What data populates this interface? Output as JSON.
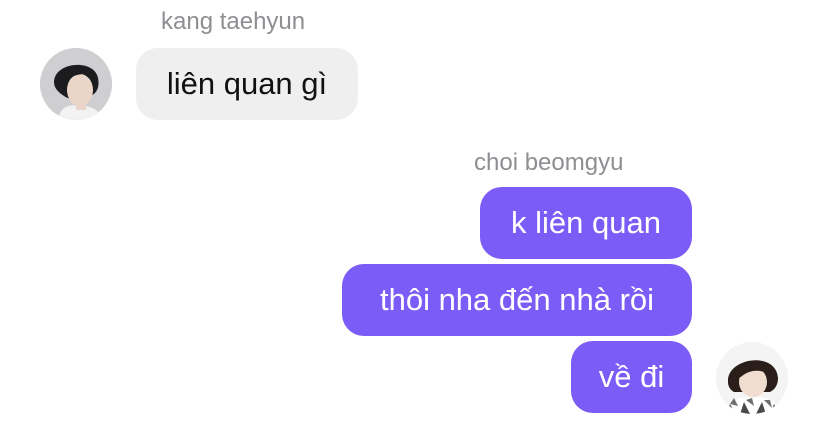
{
  "conversation": {
    "incoming": {
      "sender_name": "kang taehyun",
      "avatar_icon": "user-avatar-icon",
      "messages": [
        {
          "text": "liên quan gì"
        }
      ]
    },
    "outgoing": {
      "sender_name": "choi beomgyu",
      "avatar_icon": "user-avatar-icon",
      "messages": [
        {
          "text": "k liên quan"
        },
        {
          "text": "thôi nha đến nhà rồi"
        },
        {
          "text": "về đi"
        }
      ]
    }
  },
  "colors": {
    "incoming_bubble": "#efefef",
    "outgoing_bubble": "#7b5cf6",
    "sender_name": "#8e8e93"
  }
}
